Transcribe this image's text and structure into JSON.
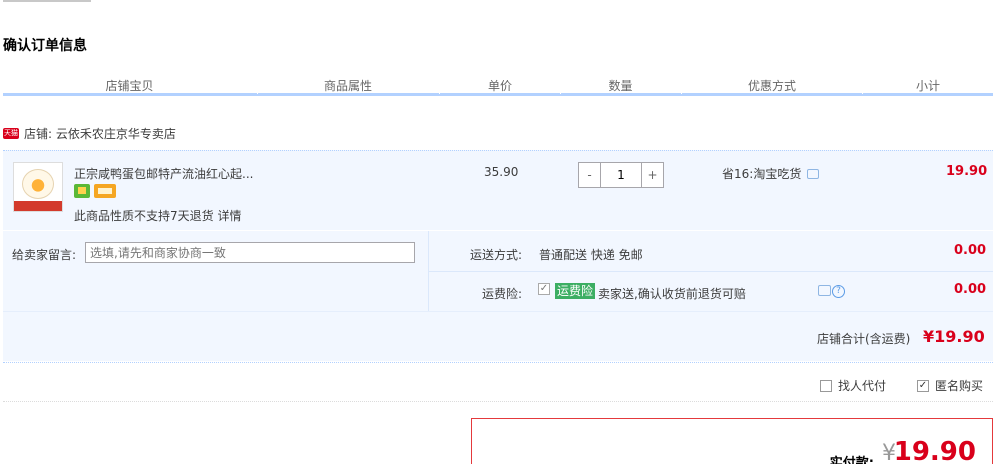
{
  "page": {
    "title": "确认订单信息"
  },
  "columns": [
    "店铺宝贝",
    "商品属性",
    "单价",
    "数量",
    "优惠方式",
    "小计"
  ],
  "shop": {
    "badge": "天猫",
    "label": "店铺: 云依禾农庄京华专卖店"
  },
  "item": {
    "title": "正宗咸鸭蛋包邮特产流油红心起...",
    "note": "此商品性质不支持7天退货 详情",
    "price": "35.90",
    "quantity": "1",
    "qty_minus": "-",
    "qty_plus": "+",
    "discount": "省16:淘宝吃货",
    "subtotal": "19.90"
  },
  "message": {
    "label": "给卖家留言:",
    "placeholder": "选填,请先和商家协商一致"
  },
  "shipping": {
    "label": "运送方式:",
    "value": "普通配送 快递 免邮",
    "price": "0.00"
  },
  "insurance": {
    "label": "运费险:",
    "tag": "运费险",
    "desc": "卖家送,确认收货前退货可赔",
    "price": "0.00",
    "check": "✓",
    "help": "?"
  },
  "shop_total": {
    "label": "店铺合计(含运费)",
    "value": "¥19.90"
  },
  "options": [
    {
      "label": "找人代付",
      "checked": false
    },
    {
      "label": "匿名购买",
      "checked": true
    }
  ],
  "payment": {
    "label": "实付款:",
    "yen": "¥",
    "amount": "19.90"
  },
  "colors": {
    "accent": "#d9001b",
    "header_line": "#b2d1ff",
    "row_bg": "#f2f7ff",
    "tag_green": "#3cae63"
  }
}
